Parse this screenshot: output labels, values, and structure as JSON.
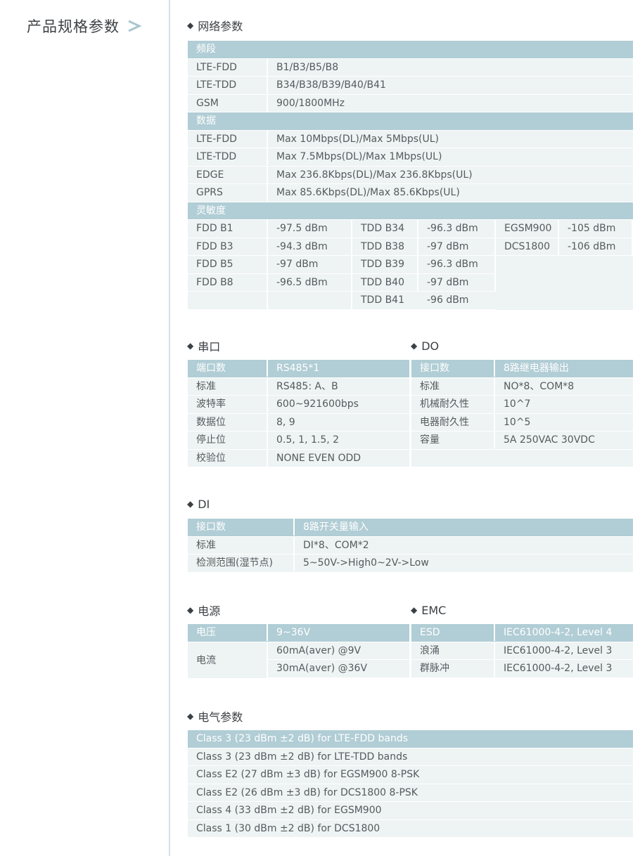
{
  "page_title": "产品规格参数",
  "network": {
    "title": "网络参数",
    "band_head": "频段",
    "bands": [
      {
        "k": "LTE-FDD",
        "v": "B1/B3/B5/B8"
      },
      {
        "k": "LTE-TDD",
        "v": "B34/B38/B39/B40/B41"
      },
      {
        "k": "GSM",
        "v": "900/1800MHz"
      }
    ],
    "data_head": "数据",
    "data": [
      {
        "k": "LTE-FDD",
        "v": "Max 10Mbps(DL)/Max 5Mbps(UL)"
      },
      {
        "k": "LTE-TDD",
        "v": "Max 7.5Mbps(DL)/Max 1Mbps(UL)"
      },
      {
        "k": "EDGE",
        "v": "Max 236.8Kbps(DL)/Max 236.8Kbps(UL)"
      },
      {
        "k": "GPRS",
        "v": "Max 85.6Kbps(DL)/Max 85.6Kbps(UL)"
      }
    ],
    "sens_head": "灵敏度",
    "fdd": [
      {
        "k": "FDD B1",
        "v": "-97.5 dBm"
      },
      {
        "k": "FDD B3",
        "v": "-94.3 dBm"
      },
      {
        "k": "FDD B5",
        "v": "-97 dBm"
      },
      {
        "k": "FDD B8",
        "v": "-96.5 dBm"
      }
    ],
    "tdd": [
      {
        "k": "TDD B34",
        "v": "-96.3 dBm"
      },
      {
        "k": "TDD B38",
        "v": "-97 dBm"
      },
      {
        "k": "TDD B39",
        "v": "-96.3 dBm"
      },
      {
        "k": "TDD B40",
        "v": "-97 dBm"
      },
      {
        "k": "TDD B41",
        "v": "-96 dBm"
      }
    ],
    "gsm": [
      {
        "k": "EGSM900",
        "v": "-105 dBm"
      },
      {
        "k": "DCS1800",
        "v": "-106 dBm"
      }
    ]
  },
  "serial": {
    "title": "串口",
    "head": {
      "k": "端口数",
      "v": "RS485*1"
    },
    "rows": [
      {
        "k": "标准",
        "v": "RS485: A、B"
      },
      {
        "k": "波特率",
        "v": "600~921600bps"
      },
      {
        "k": "数据位",
        "v": "8, 9"
      },
      {
        "k": "停止位",
        "v": "0.5, 1, 1.5, 2"
      },
      {
        "k": "校验位",
        "v": "NONE EVEN ODD"
      }
    ]
  },
  "do": {
    "title": "DO",
    "head": {
      "k": "接口数",
      "v": "8路继电器输出"
    },
    "rows": [
      {
        "k": "标准",
        "v": "NO*8、COM*8"
      },
      {
        "k": "机械耐久性",
        "v": "10^7"
      },
      {
        "k": "电器耐久性",
        "v": "10^5"
      },
      {
        "k": "容量",
        "v": "5A  250VAC 30VDC"
      }
    ]
  },
  "di": {
    "title": "DI",
    "head": {
      "k": "接口数",
      "v": "8路开关量输入"
    },
    "rows": [
      {
        "k": "标准",
        "v": "DI*8、COM*2"
      },
      {
        "k": "检测范围(湿节点)",
        "v": "5~50V->High0~2V->Low"
      }
    ]
  },
  "power": {
    "title": "电源",
    "head": {
      "k": "电压",
      "v": "9~36V"
    },
    "current_label": "电流",
    "current": [
      "60mA(aver) @9V",
      "30mA(aver) @36V"
    ]
  },
  "emc": {
    "title": "EMC",
    "head": {
      "k": "ESD",
      "v": "IEC61000-4-2, Level 4"
    },
    "rows": [
      {
        "k": "浪涌",
        "v": "IEC61000-4-2, Level 3"
      },
      {
        "k": "群脉冲",
        "v": "IEC61000-4-2, Level 3"
      }
    ]
  },
  "electrical": {
    "title": "电气参数",
    "head": "Class 3 (23 dBm  ±2 dB) for LTE-FDD bands",
    "rows": [
      "Class 3 (23 dBm  ±2 dB) for LTE-TDD bands",
      "Class E2 (27 dBm  ±3 dB) for EGSM900 8-PSK",
      "Class E2 (26 dBm  ±3 dB) for DCS1800 8-PSK",
      "Class 4 (33 dBm  ±2 dB) for EGSM900",
      "Class 1 (30 dBm  ±2 dB) for DCS1800"
    ]
  }
}
